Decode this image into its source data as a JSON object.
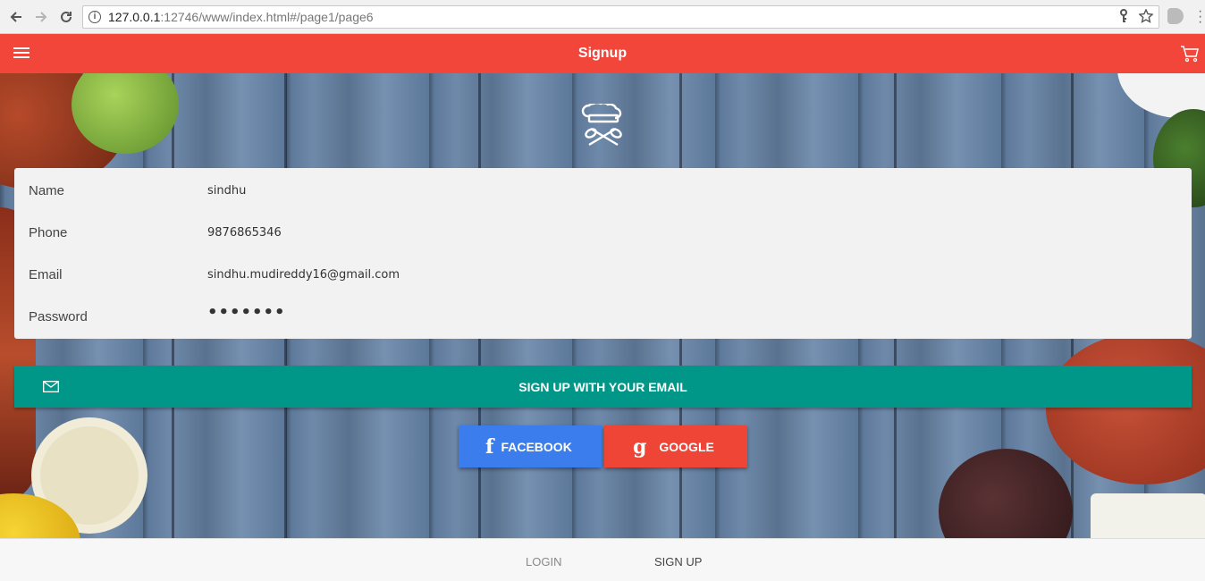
{
  "browser": {
    "url_host": "127.0.0.1",
    "url_rest": ":12746/www/index.html#/page1/page6",
    "back_icon": "arrow-left-icon",
    "forward_icon": "arrow-right-icon",
    "reload_icon": "reload-icon"
  },
  "header": {
    "title": "Signup",
    "background": "#f2463b"
  },
  "form": {
    "fields": [
      {
        "label": "Name",
        "value": "sindhu"
      },
      {
        "label": "Phone",
        "value": "9876865346"
      },
      {
        "label": "Email",
        "value": "sindhu.mudireddy16@gmail.com"
      },
      {
        "label": "Password",
        "value": "•••••••"
      }
    ]
  },
  "buttons": {
    "email_signup": "SIGN UP WITH YOUR EMAIL",
    "facebook": "FACEBOOK",
    "facebook_glyph": "f",
    "google": "GOOGLE",
    "google_glyph": "g",
    "email_color": "#009688",
    "facebook_color": "#3b7ded",
    "google_color": "#ef4536"
  },
  "tabs": {
    "login": "LOGIN",
    "signup": "SIGN UP"
  }
}
